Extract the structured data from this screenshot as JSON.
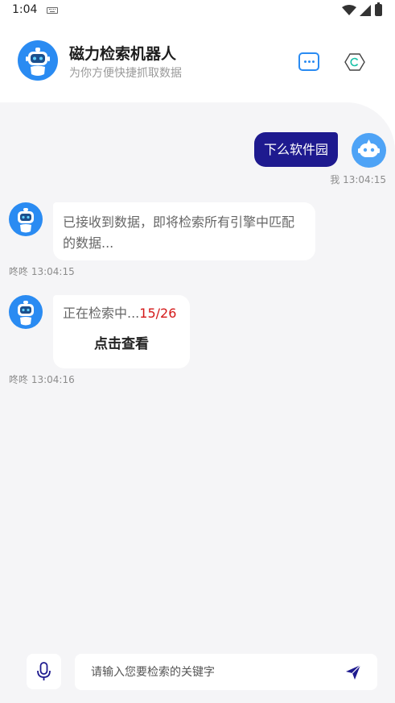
{
  "status_bar": {
    "time": "1:04"
  },
  "header": {
    "title": "磁力检索机器人",
    "subtitle": "为你方便快捷抓取数据",
    "icons": [
      "robot-avatar-icon",
      "chat-bubble-icon",
      "hexagon-refresh-icon"
    ]
  },
  "messages": [
    {
      "from": "user",
      "text": "下么软件园",
      "time": "我 13:04:15"
    },
    {
      "from": "bot",
      "text": "已接收到数据，即将检索所有引擎中匹配的数据...",
      "time": "咚咚 13:04:15"
    },
    {
      "from": "bot",
      "text": "正在检索中...",
      "progress": "15/26",
      "action": "点击查看",
      "time": "咚咚 13:04:16"
    }
  ],
  "input": {
    "placeholder": "请输入您要检索的关键字"
  },
  "colors": {
    "accent": "#2a8bf2",
    "user_bubble": "#1e1a8f",
    "progress": "#d41818",
    "chat_bg": "#f5f5f7"
  }
}
